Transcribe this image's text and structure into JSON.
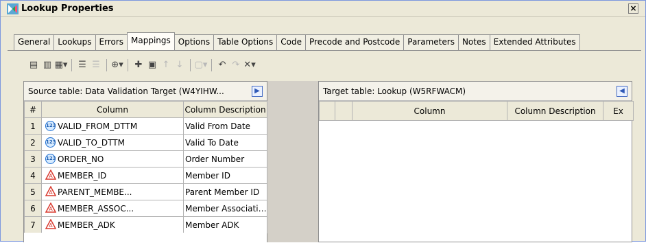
{
  "window": {
    "title": "Lookup Properties",
    "close_label": "×"
  },
  "tabs": [
    {
      "label": "General"
    },
    {
      "label": "Lookups"
    },
    {
      "label": "Errors"
    },
    {
      "label": "Mappings"
    },
    {
      "label": "Options"
    },
    {
      "label": "Table Options"
    },
    {
      "label": "Code"
    },
    {
      "label": "Precode and Postcode"
    },
    {
      "label": "Parameters"
    },
    {
      "label": "Notes"
    },
    {
      "label": "Extended Attributes"
    }
  ],
  "active_tab": "Mappings",
  "toolbar": {
    "icons": [
      {
        "name": "map-columns-icon",
        "glyph": "▤"
      },
      {
        "name": "import-columns-icon",
        "glyph": "▥"
      },
      {
        "name": "column-options-icon",
        "glyph": "▦▾"
      },
      {
        "name": "align-rows-icon",
        "glyph": "☰"
      },
      {
        "name": "disabled-list-icon",
        "glyph": "☰"
      },
      {
        "name": "expression-icon",
        "glyph": "⊕▾"
      },
      {
        "name": "new-column-icon",
        "glyph": "✚"
      },
      {
        "name": "delete-column-icon",
        "glyph": "▣"
      },
      {
        "name": "move-up-icon",
        "glyph": "↑"
      },
      {
        "name": "move-down-icon",
        "glyph": "↓"
      },
      {
        "name": "properties-icon",
        "glyph": "▢▾"
      },
      {
        "name": "undo-icon",
        "glyph": "↶"
      },
      {
        "name": "redo-icon",
        "glyph": "↷"
      },
      {
        "name": "delete-icon",
        "glyph": "✕▾"
      }
    ]
  },
  "source_table": {
    "title": "Source table: Data Validation Target (W4YIHW...",
    "columns": [
      "#",
      "Column",
      "Column Description"
    ],
    "rows": [
      {
        "num": "1",
        "icon": "numeric",
        "column": "VALID_FROM_DTTM",
        "description": "Valid From Date"
      },
      {
        "num": "2",
        "icon": "numeric",
        "column": "VALID_TO_DTTM",
        "description": "Valid To Date"
      },
      {
        "num": "3",
        "icon": "numeric",
        "column": "ORDER_NO",
        "description": "Order Number"
      },
      {
        "num": "4",
        "icon": "character",
        "column": "MEMBER_ID",
        "description": "Member ID"
      },
      {
        "num": "5",
        "icon": "character",
        "column": "PARENT_MEMBE...",
        "description": "Parent Member ID"
      },
      {
        "num": "6",
        "icon": "character",
        "column": "MEMBER_ASSOC...",
        "description": "Member Association..."
      },
      {
        "num": "7",
        "icon": "character",
        "column": "MEMBER_ADK",
        "description": "Member ADK"
      }
    ]
  },
  "target_table": {
    "title": "Target table: Lookup (W5RFWACM)",
    "columns": [
      "",
      "",
      "Column",
      "Column Description",
      "Ex"
    ]
  },
  "colors": {
    "window_bg": "#ece9d8",
    "title_accent": "#7a96df",
    "numeric_icon": "#1d6fd2",
    "character_icon": "#d93a2f"
  }
}
